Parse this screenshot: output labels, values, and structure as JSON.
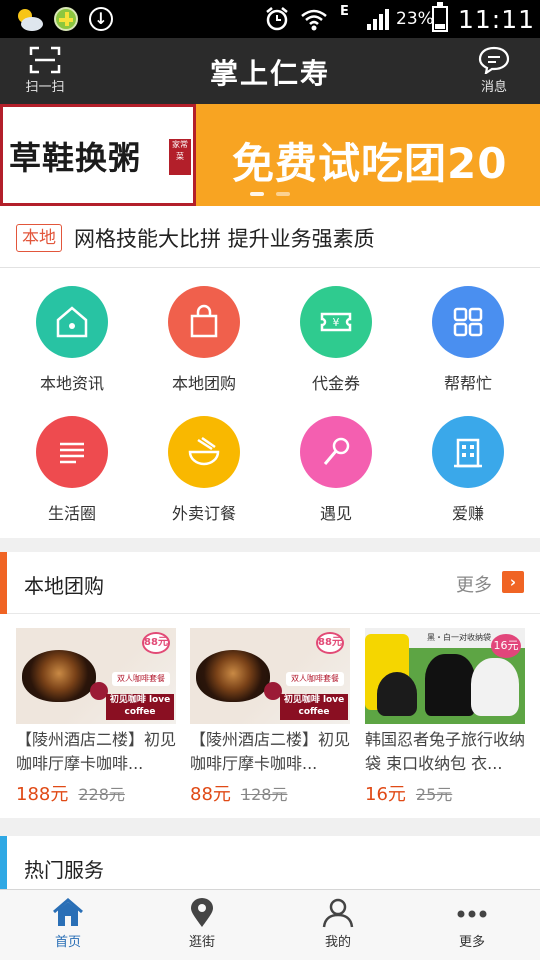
{
  "status_bar": {
    "network_label": "E",
    "battery_percent": "23%",
    "time": "11:11",
    "icons": [
      "weather-icon",
      "app-plus-icon",
      "download-icon",
      "alarm-icon",
      "wifi-icon",
      "signal-icon",
      "battery-icon"
    ]
  },
  "header": {
    "scan_label": "扫一扫",
    "title": "掌上仁寿",
    "messages_label": "消息"
  },
  "banner": {
    "left_text": "草鞋换粥",
    "seal_text": "家常菜",
    "right_text": "免费试吃团20",
    "slides": 2,
    "active_slide": 1
  },
  "news": {
    "tag": "本地",
    "text": "网格技能大比拼 提升业务强素质"
  },
  "grid": [
    {
      "label": "本地资讯",
      "color": "#28c3a3",
      "icon": "house-icon"
    },
    {
      "label": "本地团购",
      "color": "#f0604c",
      "icon": "shopping-bag-icon"
    },
    {
      "label": "代金券",
      "color": "#2fcb8f",
      "icon": "coupon-icon"
    },
    {
      "label": "帮帮忙",
      "color": "#4a8ff0",
      "icon": "apps-icon"
    },
    {
      "label": "生活圈",
      "color": "#ee4b4f",
      "icon": "lines-icon"
    },
    {
      "label": "外卖订餐",
      "color": "#f9b800",
      "icon": "bowl-icon"
    },
    {
      "label": "遇见",
      "color": "#f45fb0",
      "icon": "microphone-icon"
    },
    {
      "label": "爱赚",
      "color": "#3aa8ea",
      "icon": "building-icon"
    }
  ],
  "groupbuy": {
    "title": "本地团购",
    "more_label": "更多",
    "accent": "#f06424",
    "items": [
      {
        "title": "【陵州酒店二楼】初见咖啡厅摩卡咖啡...",
        "price": "188元",
        "old_price": "228元",
        "badge": "88元",
        "pill": "双人咖啡套餐",
        "strip": "初见咖啡 love coffee"
      },
      {
        "title": "【陵州酒店二楼】初见咖啡厅摩卡咖啡...",
        "price": "88元",
        "old_price": "128元",
        "badge": "88元",
        "pill": "双人咖啡套餐",
        "strip": "初见咖啡 love coffee"
      },
      {
        "title": "韩国忍者兔子旅行收纳袋 束口收纳包 衣...",
        "price": "16元",
        "old_price": "25元",
        "badge": "16元",
        "top_text": "黑・白一对收纳袋"
      }
    ]
  },
  "hot_services": {
    "title": "热门服务",
    "accent": "#2fa8e4"
  },
  "tabbar": {
    "active_color": "#2a6fb6",
    "tabs": [
      {
        "label": "首页",
        "icon": "home-icon",
        "active": true
      },
      {
        "label": "逛街",
        "icon": "location-pin-icon",
        "active": false
      },
      {
        "label": "我的",
        "icon": "person-icon",
        "active": false
      },
      {
        "label": "更多",
        "icon": "more-dots-icon",
        "active": false
      }
    ]
  }
}
